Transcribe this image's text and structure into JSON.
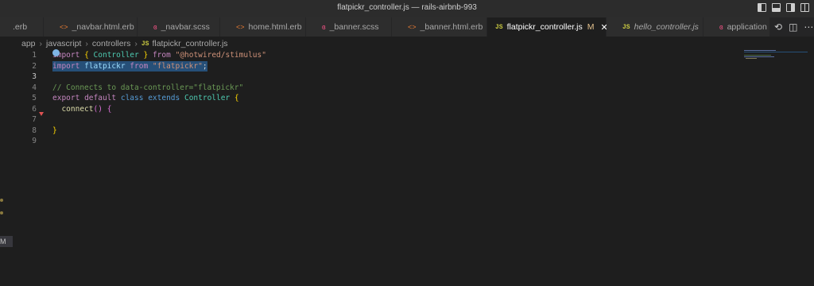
{
  "window": {
    "title": "flatpickr_controller.js — rails-airbnb-993"
  },
  "tabs": [
    {
      "label": ".erb",
      "icon": "html",
      "italic": false,
      "active": false,
      "modified": false
    },
    {
      "label": "_navbar.html.erb",
      "icon": "html",
      "italic": false,
      "active": false,
      "modified": false
    },
    {
      "label": "_navbar.scss",
      "icon": "scss",
      "italic": false,
      "active": false,
      "modified": false
    },
    {
      "label": "home.html.erb",
      "icon": "html",
      "italic": false,
      "active": false,
      "modified": false
    },
    {
      "label": "_banner.scss",
      "icon": "scss",
      "italic": false,
      "active": false,
      "modified": false
    },
    {
      "label": "_banner.html.erb",
      "icon": "html",
      "italic": false,
      "active": false,
      "modified": false
    },
    {
      "label": "flatpickr_controller.js",
      "icon": "js",
      "italic": false,
      "active": true,
      "modified": true,
      "modified_label": "M",
      "close_label": "✕"
    },
    {
      "label": "hello_controller.js",
      "icon": "js",
      "italic": true,
      "active": false,
      "modified": false
    },
    {
      "label": "application",
      "icon": "scss",
      "italic": false,
      "active": false,
      "modified": false
    }
  ],
  "icon_glyphs": {
    "html": "<>",
    "scss": "ɞ",
    "js": "JS"
  },
  "breadcrumbs": {
    "items": [
      "app",
      "javascript",
      "controllers",
      "flatpickr_controller.js"
    ],
    "separator": "›",
    "file_icon": "JS"
  },
  "editor": {
    "current_line": 3,
    "lines": [
      {
        "n": "1",
        "tokens": [
          [
            "kw",
            "import"
          ],
          [
            "p",
            " "
          ],
          [
            "br1",
            "{"
          ],
          [
            "p",
            " "
          ],
          [
            "cls",
            "Controller"
          ],
          [
            "p",
            " "
          ],
          [
            "br1",
            "}"
          ],
          [
            "p",
            " "
          ],
          [
            "kw",
            "from"
          ],
          [
            "p",
            " "
          ],
          [
            "str",
            "\"@hotwired/stimulus\""
          ]
        ]
      },
      {
        "n": "2",
        "selected": true,
        "tokens": [
          [
            "kw",
            "import"
          ],
          [
            "p",
            " "
          ],
          [
            "var",
            "flatpickr"
          ],
          [
            "p",
            " "
          ],
          [
            "kw",
            "from"
          ],
          [
            "p",
            " "
          ],
          [
            "str",
            "\"flatpickr\""
          ],
          [
            "p",
            ";"
          ]
        ]
      },
      {
        "n": "3",
        "tokens": []
      },
      {
        "n": "4",
        "tokens": [
          [
            "cmt",
            "// Connects to data-controller=\"flatpickr\""
          ]
        ]
      },
      {
        "n": "5",
        "tokens": [
          [
            "kw",
            "export"
          ],
          [
            "p",
            " "
          ],
          [
            "kw",
            "default"
          ],
          [
            "p",
            " "
          ],
          [
            "kw2",
            "class"
          ],
          [
            "p",
            " "
          ],
          [
            "kw2",
            "extends"
          ],
          [
            "p",
            " "
          ],
          [
            "cls",
            "Controller"
          ],
          [
            "p",
            " "
          ],
          [
            "br1",
            "{"
          ]
        ]
      },
      {
        "n": "6",
        "tokens": [
          [
            "p",
            "  "
          ],
          [
            "fn",
            "connect"
          ],
          [
            "br2",
            "()"
          ],
          [
            "p",
            " "
          ],
          [
            "br2",
            "{"
          ]
        ]
      },
      {
        "n": "7",
        "tokens": [
          [
            "p",
            "  "
          ]
        ]
      },
      {
        "n": "8",
        "tokens": [
          [
            "br1",
            "}"
          ]
        ]
      },
      {
        "n": "9",
        "tokens": []
      }
    ]
  },
  "sidebar_badge": "M",
  "colors": {
    "editor_bg": "#1e1e1e",
    "tab_bar_bg": "#252526",
    "selection": "#264f78",
    "keyword": "#c586c0",
    "string": "#ce9178",
    "comment": "#6a9955",
    "class": "#4ec9b0"
  }
}
